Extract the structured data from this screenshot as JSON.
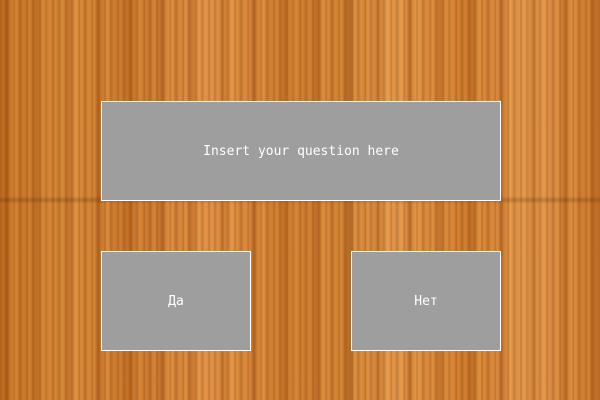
{
  "background": {
    "texture": "wood-planks",
    "base_color": "#cf7a2a"
  },
  "question": {
    "text": "Insert your question here",
    "box_color": "#9e9e9e",
    "text_color": "#ffffff"
  },
  "buttons": {
    "yes_label": "Да",
    "no_label": "Нет"
  }
}
